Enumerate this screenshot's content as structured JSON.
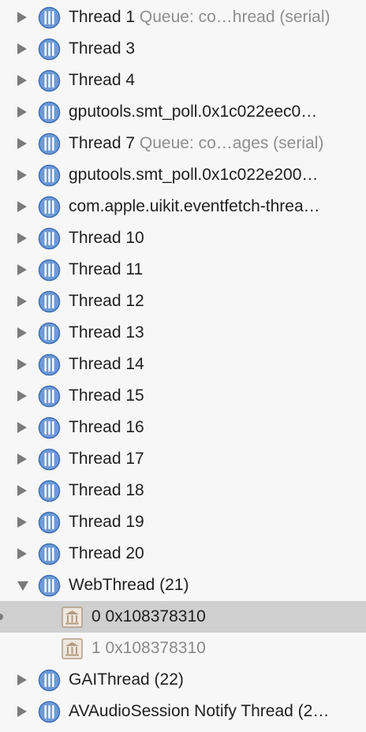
{
  "threads_before": [
    {
      "name": "Thread 1",
      "queue": "Queue: co…hread (serial)"
    },
    {
      "name": "Thread 3",
      "queue": ""
    },
    {
      "name": "Thread 4",
      "queue": ""
    },
    {
      "name": "gputools.smt_poll.0x1c022eec0…",
      "queue": ""
    },
    {
      "name": "Thread 7",
      "queue": "Queue: co…ages (serial)"
    },
    {
      "name": "gputools.smt_poll.0x1c022e200…",
      "queue": ""
    },
    {
      "name": "com.apple.uikit.eventfetch-threa…",
      "queue": ""
    },
    {
      "name": "Thread 10",
      "queue": ""
    },
    {
      "name": "Thread 11",
      "queue": ""
    },
    {
      "name": "Thread 12",
      "queue": ""
    },
    {
      "name": "Thread 13",
      "queue": ""
    },
    {
      "name": "Thread 14",
      "queue": ""
    },
    {
      "name": "Thread 15",
      "queue": ""
    },
    {
      "name": "Thread 16",
      "queue": ""
    },
    {
      "name": "Thread 17",
      "queue": ""
    },
    {
      "name": "Thread 18",
      "queue": ""
    },
    {
      "name": "Thread 19",
      "queue": ""
    },
    {
      "name": "Thread 20",
      "queue": ""
    }
  ],
  "expanded_thread": {
    "name": "WebThread (21)",
    "frames": [
      {
        "label": "0 0x108378310",
        "selected": true
      },
      {
        "label": "1 0x108378310",
        "selected": false
      }
    ]
  },
  "threads_after": [
    {
      "name": "GAIThread (22)",
      "queue": ""
    },
    {
      "name": "AVAudioSession Notify Thread (2…",
      "queue": ""
    }
  ],
  "icons": {
    "thread": "thread-icon",
    "frame": "stack-frame-icon",
    "collapsed": "disclosure-triangle-right",
    "expanded": "disclosure-triangle-down"
  },
  "colors": {
    "thread_icon_fill": "#6f9ad6",
    "frame_icon_fill": "#c9b8a4",
    "selection": "#cfcfcf",
    "queue_text": "#8e8e8e"
  }
}
